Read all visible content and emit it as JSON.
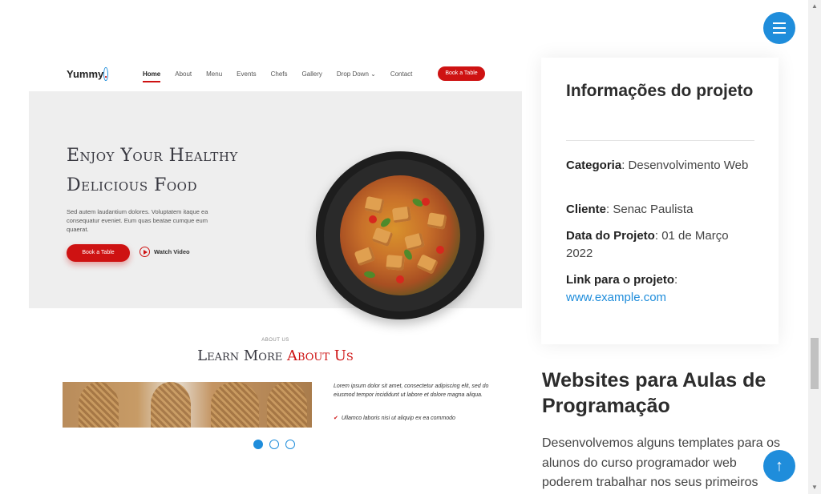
{
  "preview": {
    "logo": "Yummy",
    "logo_dot": ".",
    "menu": [
      "Home",
      "About",
      "Menu",
      "Events",
      "Chefs",
      "Gallery",
      "Drop Down ⌄",
      "Contact"
    ],
    "book_label": "Book a Table",
    "hero_title_line1": "Enjoy Your Healthy",
    "hero_title_line2": "Delicious Food",
    "hero_text": "Sed autem laudantium dolores. Voluptatem itaque ea consequatur eveniet. Eum quas beatae cumque eum quaerat.",
    "hero_book_label": "Book a Table",
    "watch_label": "Watch Video",
    "about_small": "ABOUT US",
    "about_title": "Learn More ",
    "about_title_accent": "About Us",
    "about_text": "Lorem ipsum dolor sit amet, consectetur adipiscing elit, sed do eiusmod tempor incididunt ut labore et dolore magna aliqua.",
    "about_check": "Ullamco laboris nisi ut aliquip ex ea commodo"
  },
  "carousel": {
    "total": 3,
    "active": 1
  },
  "info": {
    "title": "Informações do projeto",
    "category_label": "Categoria",
    "category_value": ": Desenvolvimento Web",
    "client_label": "Cliente",
    "client_value": ": Senac Paulista",
    "date_label": "Data do Projeto",
    "date_value": ": 01 de Março 2022",
    "link_label": "Link para o projeto",
    "link_suffix": ":",
    "link_value": "www.example.com"
  },
  "section": {
    "title": "Websites para Aulas de Programação",
    "text": "Desenvolvemos alguns templates para os alunos do curso programador web poderem trabalhar nos seus primeiros"
  },
  "icons": {
    "menu": "hamburger-icon",
    "top": "arrow-up-icon",
    "play": "play-icon"
  },
  "colors": {
    "accent": "#1f8ddb",
    "brand_red": "#ce1212"
  }
}
